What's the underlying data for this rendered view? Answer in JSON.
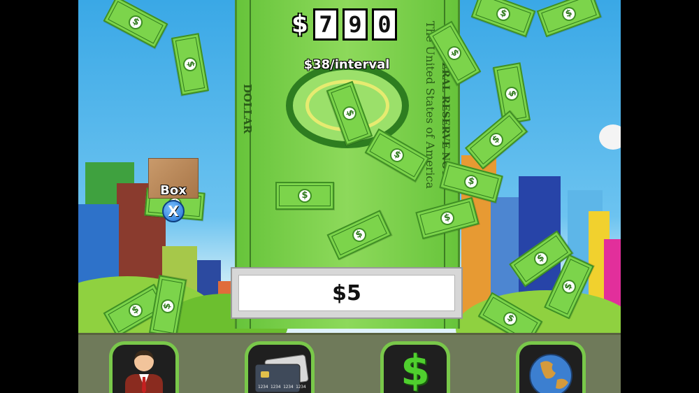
{
  "hud": {
    "currency_symbol": "$",
    "money_digits": [
      "7",
      "9",
      "0"
    ],
    "rate_text": "$38/interval"
  },
  "bill_text": {
    "dollar": "DOLLAR",
    "united_states": "The United States of America",
    "federal_reserve": "FEDERAL RESERVE NOTE",
    "bill_glyph": "$"
  },
  "item": {
    "label": "Box",
    "cancel_glyph": "X"
  },
  "purchase": {
    "price": "$5"
  },
  "toolbar": {
    "buttons": [
      {
        "icon": "businessman-icon"
      },
      {
        "icon": "credit-cards-icon",
        "card_number": "1234 1234 1234 1234"
      },
      {
        "icon": "dollar-sign-icon",
        "glyph": "$"
      },
      {
        "icon": "globe-icon"
      }
    ]
  },
  "colors": {
    "bill_green": "#7cd44b",
    "button_border": "#79c84a",
    "sky": "#3aa8e6"
  }
}
